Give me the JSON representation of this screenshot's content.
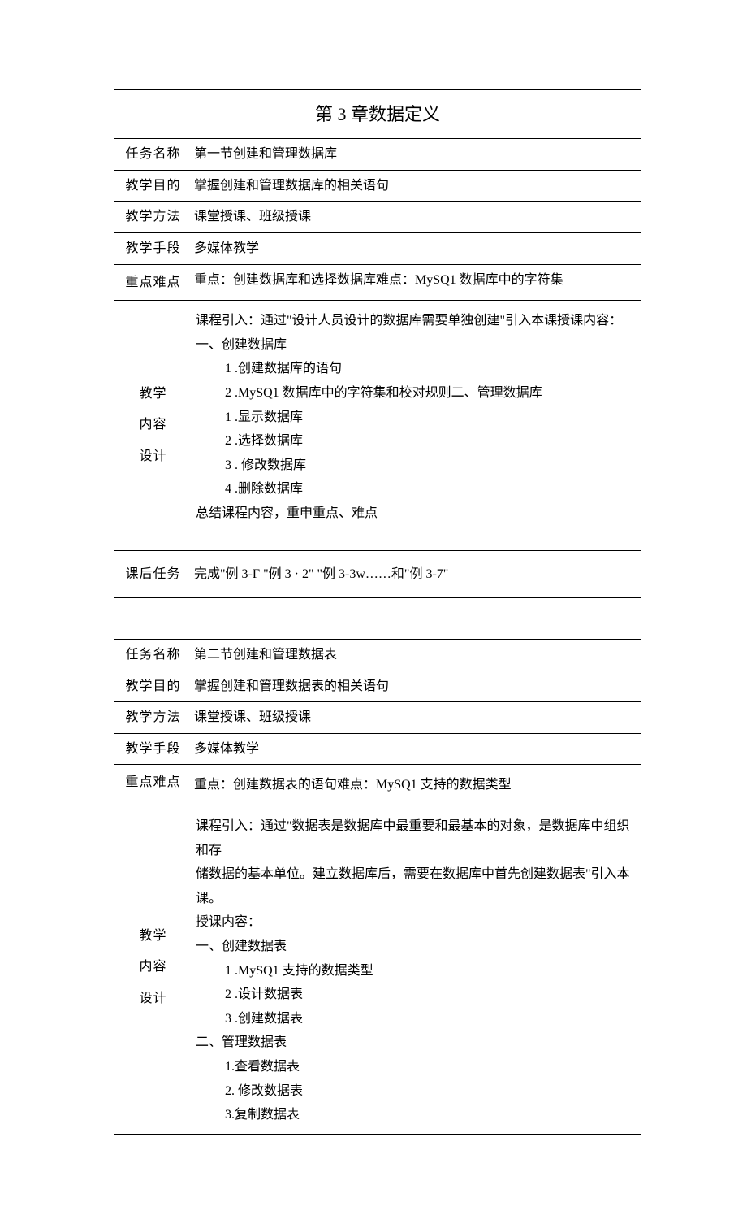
{
  "table1": {
    "title": "第 3 章数据定义",
    "r1": {
      "label": "任务名称",
      "value": "第一节创建和管理数据库"
    },
    "r2": {
      "label": "教学目的",
      "value": "掌握创建和管理数据库的相关语句"
    },
    "r3": {
      "label": "教学方法",
      "value": "课堂授课、班级授课"
    },
    "r4": {
      "label": "教学手段",
      "value": "多媒体教学"
    },
    "r5": {
      "label": "重点难点",
      "value": "重点：创建数据库和选择数据库难点：MySQ1 数据库中的字符集"
    },
    "content": {
      "l1": "教学",
      "l2": "内容",
      "l3": "设计",
      "p0": "课程引入：通过\"设计人员设计的数据库需要单独创建\"引入本课授课内容：",
      "p1": "一、创建数据库",
      "p2": "1 .创建数据库的语句",
      "p3": "2 .MySQ1 数据库中的字符集和校对规则二、管理数据库",
      "p4": "1 .显示数据库",
      "p5": "2 .选择数据库",
      "p6": "3 . 修改数据库",
      "p7": "4 .删除数据库",
      "p8": "总结课程内容，重申重点、难点"
    },
    "r7": {
      "label": "课后任务",
      "value": "完成\"例 3-Γ \"例 3 · 2\" \"例 3-3w……和\"例 3-7\""
    }
  },
  "table2": {
    "r1": {
      "label": "任务名称",
      "value": "第二节创建和管理数据表"
    },
    "r2": {
      "label": "教学目的",
      "value": "掌握创建和管理数据表的相关语句"
    },
    "r3": {
      "label": "教学方法",
      "value": "课堂授课、班级授课"
    },
    "r4": {
      "label": "教学手段",
      "value": "多媒体教学"
    },
    "r5": {
      "label": "重点难点",
      "value": "重点：创建数据表的语句难点：MySQ1 支持的数据类型"
    },
    "content": {
      "l1": "教学",
      "l2": "内容",
      "l3": "设计",
      "p0a": "课程引入：通过\"数据表是数据库中最重要和最基本的对象，是数据库中组织和存",
      "p0b": "储数据的基本单位。建立数据库后，需要在数据库中首先创建数据表\"引入本课。",
      "p1": "授课内容：",
      "p2": "一、创建数据表",
      "p3": "1 .MySQ1 支持的数据类型",
      "p4": "2 .设计数据表",
      "p5": "3 .创建数据表",
      "p6": "二、管理数据表",
      "p7": "1.查看数据表",
      "p8": "2. 修改数据表",
      "p9": "3.复制数据表"
    }
  }
}
